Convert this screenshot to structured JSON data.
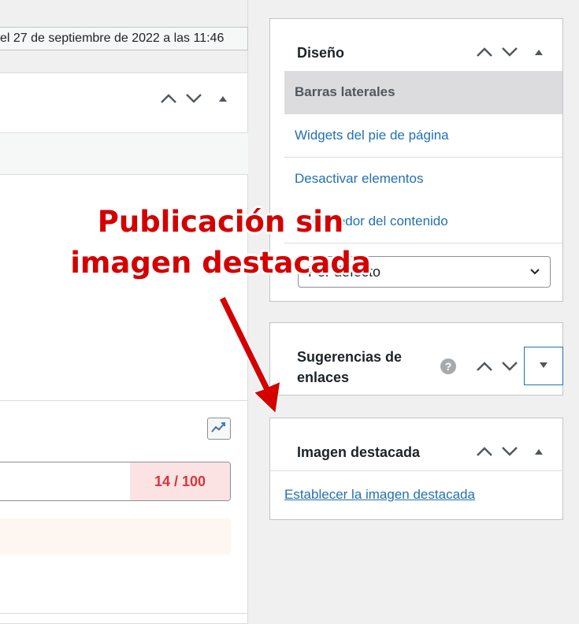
{
  "editor": {
    "last_edited": "el 27 de septiembre de 2022 a las 11:46",
    "seo_score": "14 / 100"
  },
  "sidebar": {
    "diseno": {
      "title": "Diseño",
      "items": [
        {
          "label": "Barras laterales"
        },
        {
          "label": "Widgets del pie de página"
        },
        {
          "label": "Desactivar elementos"
        },
        {
          "label": "Contenedor del contenido"
        }
      ],
      "select_value": "Por defecto"
    },
    "sugerencias": {
      "title_line1": "Sugerencias de",
      "title_line2": "enlaces",
      "help_glyph": "?"
    },
    "imagen": {
      "title": "Imagen destacada",
      "link": "Establecer la imagen destacada"
    }
  },
  "annotation": {
    "line1": "Publicación sin",
    "line2": "imagen destacada",
    "color": "#d40000"
  },
  "colors": {
    "accent": "#2271b1",
    "score_bad": "#d63638"
  }
}
